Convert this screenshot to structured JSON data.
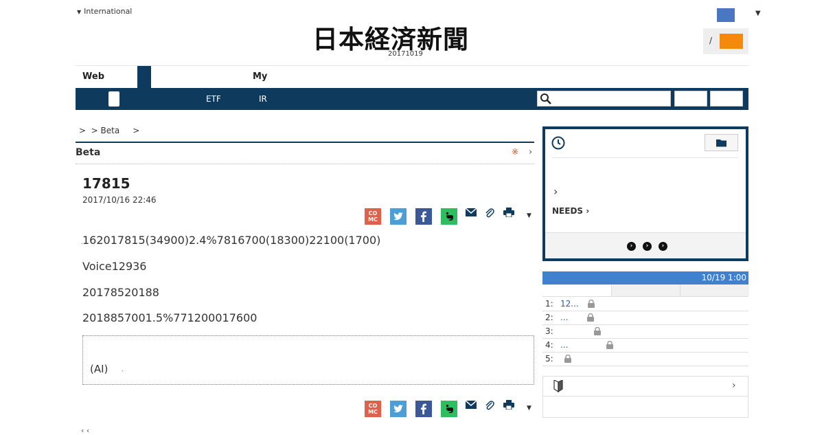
{
  "header": {
    "international_label": "International",
    "logo_text": "日本経済新聞",
    "date": "20171019",
    "login_separator": "/"
  },
  "nav": {
    "web_label": "Web",
    "my_label": "My",
    "bar_items": [
      "ETF",
      "IR"
    ]
  },
  "breadcrumb": ">  > Beta     >",
  "section": {
    "title": "Beta",
    "mark": "※",
    "chevron": "›"
  },
  "article": {
    "title": "17815",
    "datetime": "2017/10/16 22:46",
    "paragraphs": [
      "162017815(34900)2.4%7816700(18300)22100(1700)",
      "Voice12936",
      "20178520188",
      "2018857001.5%771200017600"
    ],
    "ai_note": "(AI)",
    "share_cm": "CO\nMC"
  },
  "sidebar": {
    "needs_label": "NEEDS",
    "chevron": "›",
    "ranking": {
      "time": "10/19 1:00",
      "rows": [
        {
          "num": "1:",
          "title": "12..."
        },
        {
          "num": "2:",
          "title": "..."
        },
        {
          "num": "3:",
          "title": ""
        },
        {
          "num": "4:",
          "title": "..."
        },
        {
          "num": "5:",
          "title": ""
        }
      ]
    }
  },
  "colors": {
    "navy": "#0e3a5e",
    "orange": "#f5890c",
    "ranking_blue": "#3f80cf"
  }
}
